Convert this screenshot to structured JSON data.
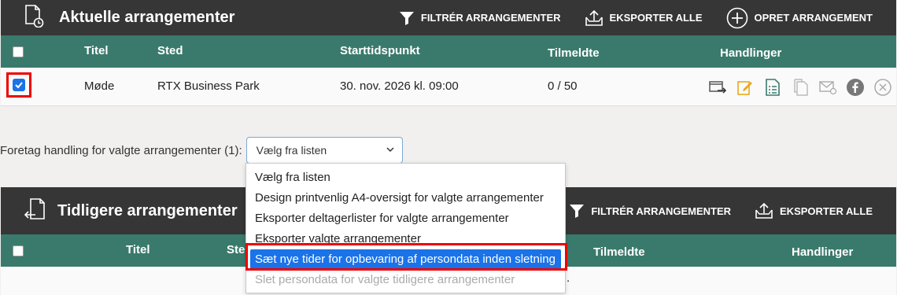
{
  "current": {
    "title": "Aktuelle arrangementer",
    "actions": {
      "filter": "FILTRÉR ARRANGEMENTER",
      "export_all": "EKSPORTER ALLE",
      "create": "OPRET ARRANGEMENT"
    },
    "columns": {
      "title": "Titel",
      "location": "Sted",
      "start": "Starttidspunkt",
      "registered": "Tilmeldte",
      "actions": "Handlinger"
    },
    "rows": [
      {
        "title": "Møde",
        "location": "RTX Business Park",
        "start": "30. nov. 2026 kl. 09:00",
        "registered": "0 / 50",
        "checked": true
      }
    ]
  },
  "bulk_action": {
    "label": "Foretag handling for valgte arrangementer (1):",
    "selected": "Vælg fra listen",
    "options": [
      "Vælg fra listen",
      "Design printvenlig A4-oversigt for valgte arrangementer",
      "Eksporter deltagerlister for valgte arrangementer",
      "Eksporter valgte arrangementer",
      "Sæt nye tider for opbevaring af persondata inden sletning",
      "Slet persondata for valgte tidligere arrangementer"
    ],
    "highlighted_index": 4,
    "disabled_index": 5
  },
  "previous": {
    "title": "Tidligere arrangementer",
    "actions": {
      "filter": "FILTRÉR ARRANGEMENTER",
      "export_all": "EKSPORTER ALLE"
    },
    "columns": {
      "title": "Titel",
      "location": "Ste",
      "registered": "Tilmeldte",
      "actions": "Handlinger"
    },
    "partial_cell": "."
  },
  "colors": {
    "header": "#363636",
    "table_header": "#3a7a6c",
    "accent": "#1a73e8",
    "highlight": "#e00000"
  }
}
